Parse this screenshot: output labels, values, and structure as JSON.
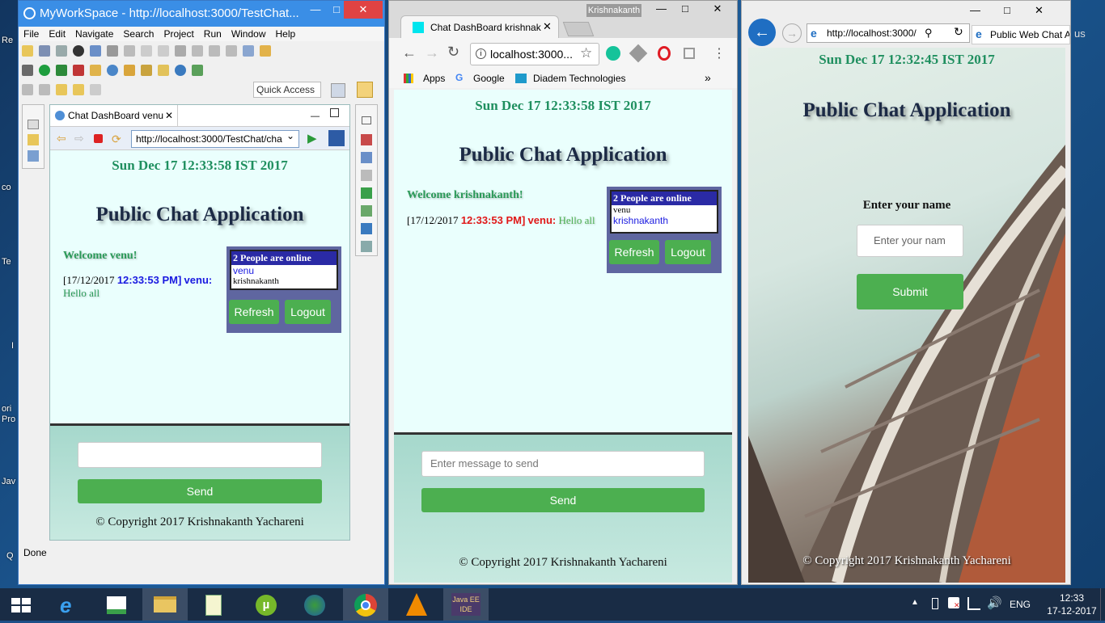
{
  "desktop": {
    "icon_labels": [
      "Re",
      "co",
      "Te",
      "I",
      "ori Pro",
      "Jav",
      "Q"
    ]
  },
  "eclipse": {
    "title": "MyWorkSpace - http://localhost:3000/TestChat...",
    "menu": [
      "File",
      "Edit",
      "Navigate",
      "Search",
      "Project",
      "Run",
      "Window",
      "Help"
    ],
    "quick_access": "Quick Access",
    "tab_label": "Chat DashBoard venu",
    "url": "http://localhost:3000/TestChat/cha",
    "status": "Done",
    "page": {
      "date": "Sun Dec 17 12:33:58 IST 2017",
      "title": "Public Chat Application",
      "welcome": "Welcome venu!",
      "message": {
        "date": "[17/12/2017",
        "time": "12:33:53 PM]",
        "user": "venu:",
        "text": "Hello all"
      },
      "online_header": "2 People are online",
      "online_users": [
        "venu",
        "krishnakanth"
      ],
      "refresh": "Refresh",
      "logout": "Logout",
      "input_placeholder": "",
      "send": "Send",
      "copyright": "© Copyright 2017 Krishnakanth Yachareni"
    }
  },
  "chrome": {
    "profile": "Krishnakanth",
    "tab_label": "Chat DashBoard krishnak",
    "url": "localhost:3000...",
    "bookmarks": [
      "Apps",
      "Google",
      "Diadem Technologies"
    ],
    "page": {
      "date": "Sun Dec 17 12:33:58 IST 2017",
      "title": "Public Chat Application",
      "welcome": "Welcome krishnakanth!",
      "message": {
        "date": "[17/12/2017",
        "time": "12:33:53 PM]",
        "user": "venu:",
        "text": "Hello all"
      },
      "online_header": "2 People are online",
      "online_users": [
        "venu",
        "krishnakanth"
      ],
      "refresh": "Refresh",
      "logout": "Logout",
      "input_placeholder": "Enter message to send",
      "send": "Send",
      "copyright": "© Copyright 2017 Krishnakanth Yachareni"
    }
  },
  "ie": {
    "url": "http://localhost:3000/",
    "tab_label": "Public Web Chat A",
    "page": {
      "date": "Sun Dec 17 12:32:45 IST 2017",
      "title": "Public Chat Application",
      "name_label": "Enter your name",
      "name_placeholder": "Enter your nam",
      "submit": "Submit",
      "copyright": "© Copyright 2017 Krishnakanth Yachareni"
    }
  },
  "taskbar": {
    "language": "ENG",
    "time": "12:33",
    "date": "17-12-2017",
    "colors": {
      "bar": "#192c45",
      "active": "#3b4d66"
    }
  },
  "colors": {
    "send_button": "#4caf50",
    "date_text": "#1f8f5f",
    "online_header_bg": "#2a2aa5",
    "online_panel_bg": "#5f66a0",
    "message_time_blue": "#1a1ae0",
    "message_time_red": "#e01818"
  }
}
